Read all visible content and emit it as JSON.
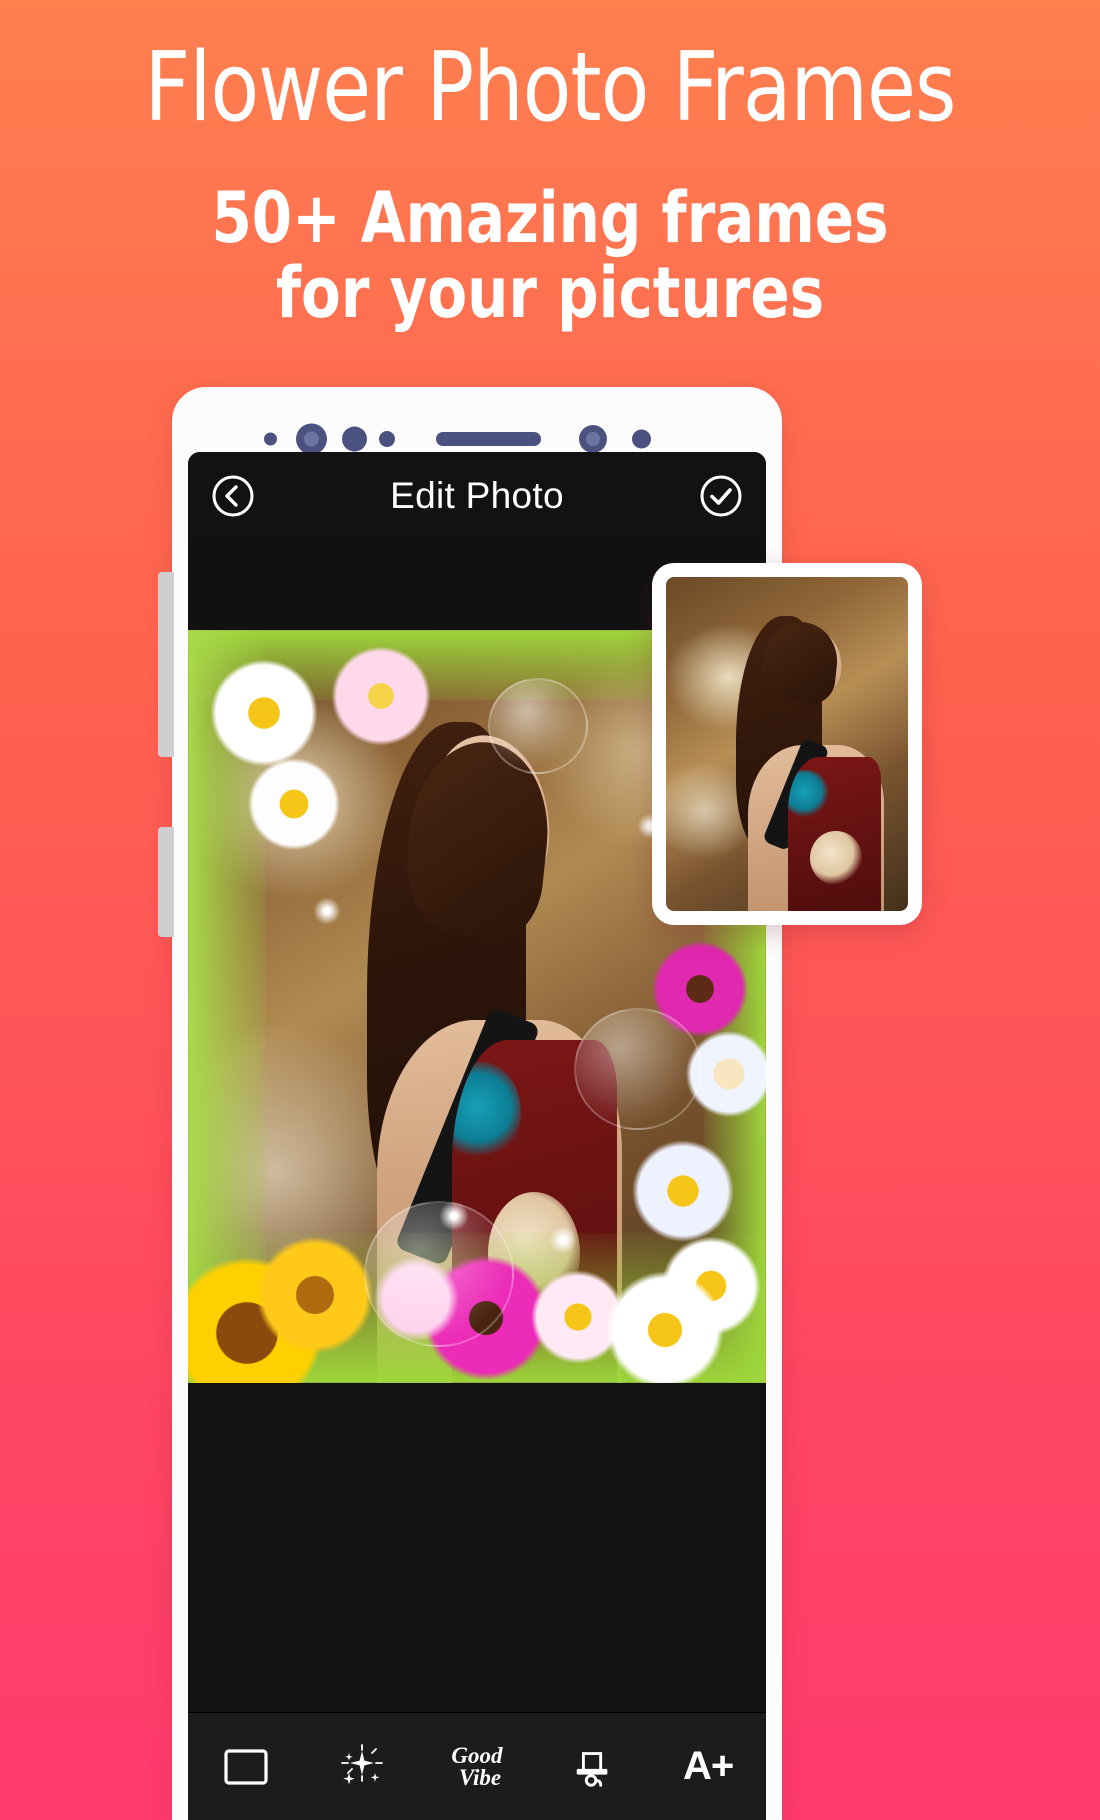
{
  "promo": {
    "title": "Flower Photo Frames",
    "subtitle_line1": "50+ Amazing frames",
    "subtitle_line2": "for your pictures"
  },
  "colors": {
    "gradient_top": "#FF7F4F",
    "gradient_bottom": "#FF3A6E",
    "phone_body": "#FCFCFC",
    "screen_bg": "#121212",
    "toolbar_bg": "#1C1C1E",
    "sensor_dot": "#4B5280",
    "side_button": "#CFCFCF",
    "icon_white": "#FFFFFF"
  },
  "phone": {
    "sensors": [
      {
        "name": "sensor-dot-small-1",
        "size": 13
      },
      {
        "name": "proximity-sensor",
        "size": 30
      },
      {
        "name": "front-camera",
        "size": 24
      },
      {
        "name": "sensor-dot-small-2",
        "size": 15
      },
      {
        "name": "earpiece-speaker",
        "size": 0
      },
      {
        "name": "sensor-dot-right-1",
        "size": 27
      },
      {
        "name": "sensor-dot-right-2",
        "size": 18
      }
    ],
    "side_buttons": [
      "volume-button",
      "power-button"
    ]
  },
  "app": {
    "header": {
      "back_icon": "circle-chevron-left-icon",
      "title": "Edit Photo",
      "confirm_icon": "circle-check-icon"
    },
    "editor": {
      "frame_name": "flower-frame-overlay",
      "photo_name": "user-photo-woman-portrait"
    },
    "toolbar": [
      {
        "name": "tab-frames",
        "icon": "picture-frame-icon",
        "label": ""
      },
      {
        "name": "tab-effects",
        "icon": "sparkle-magic-icon",
        "label": ""
      },
      {
        "name": "tab-overlays",
        "icon": "good-vibe-script-icon",
        "label_line1": "Good",
        "label_line2": "Vibe"
      },
      {
        "name": "tab-stickers",
        "icon": "top-hat-monocle-icon",
        "label": ""
      },
      {
        "name": "tab-text",
        "icon": "text-add-icon",
        "label": "A+"
      }
    ]
  },
  "thumbnail_card": {
    "name": "original-photo-preview",
    "content": "user-photo-woman-portrait"
  }
}
